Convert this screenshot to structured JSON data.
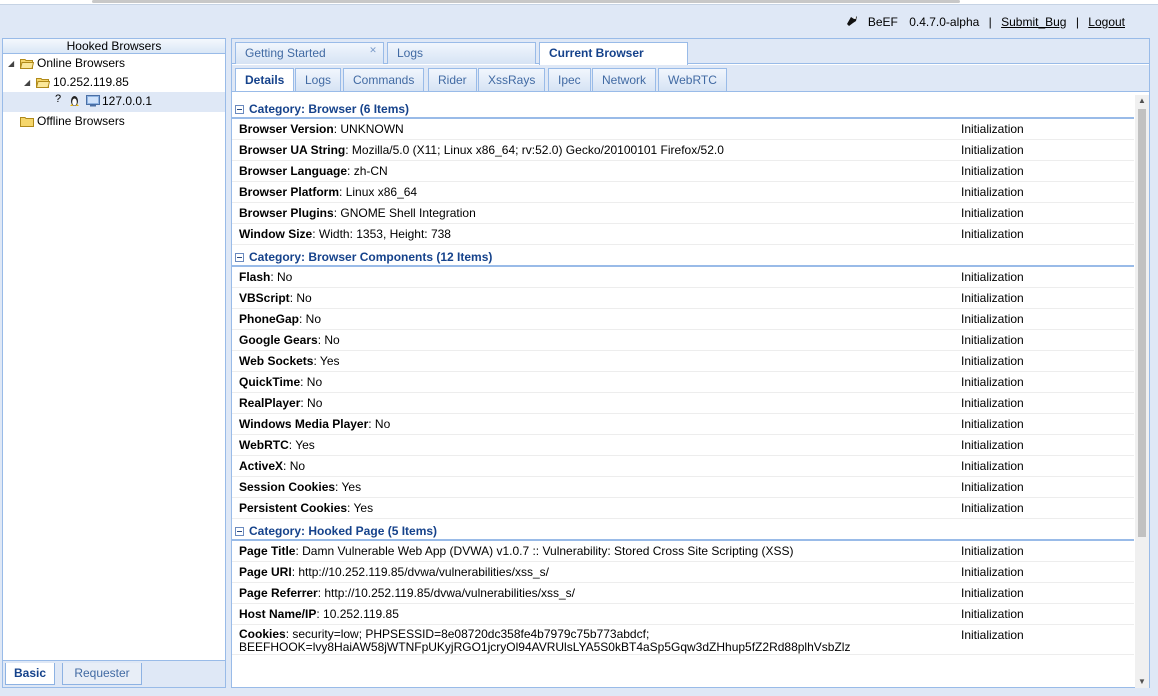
{
  "header": {
    "app_name": "BeEF",
    "version": "0.4.7.0-alpha",
    "submit_bug": "Submit_Bug",
    "logout": "Logout",
    "separator": "|"
  },
  "left_panel": {
    "title": "Hooked Browsers",
    "tree": {
      "online": "Online Browsers",
      "host": "10.252.119.85",
      "browser_ip": "127.0.0.1",
      "browser_unknown_mark": "?",
      "offline": "Offline Browsers"
    },
    "bottom_tabs": [
      "Basic",
      "Requester"
    ]
  },
  "main_tabs": [
    {
      "label": "Getting Started",
      "closable": true
    },
    {
      "label": "Logs"
    },
    {
      "label": "Current Browser",
      "active": true
    }
  ],
  "sub_tabs": [
    "Details",
    "Logs",
    "Commands",
    "Rider",
    "XssRays",
    "Ipec",
    "Network",
    "WebRTC"
  ],
  "categories": [
    {
      "title": "Category: Browser (6 Items)",
      "rows": [
        {
          "key": "Browser Version",
          "value": ": UNKNOWN",
          "source": "Initialization"
        },
        {
          "key": "Browser UA String",
          "value": ": Mozilla/5.0 (X11; Linux x86_64; rv:52.0) Gecko/20100101 Firefox/52.0",
          "source": "Initialization"
        },
        {
          "key": "Browser Language",
          "value": ": zh-CN",
          "source": "Initialization"
        },
        {
          "key": "Browser Platform",
          "value": ": Linux x86_64",
          "source": "Initialization"
        },
        {
          "key": "Browser Plugins",
          "value": ": GNOME Shell Integration",
          "source": "Initialization"
        },
        {
          "key": "Window Size",
          "value": ": Width: 1353, Height: 738",
          "source": "Initialization"
        }
      ]
    },
    {
      "title": "Category: Browser Components (12 Items)",
      "rows": [
        {
          "key": "Flash",
          "value": ": No",
          "source": "Initialization"
        },
        {
          "key": "VBScript",
          "value": ": No",
          "source": "Initialization"
        },
        {
          "key": "PhoneGap",
          "value": ": No",
          "source": "Initialization"
        },
        {
          "key": "Google Gears",
          "value": ": No",
          "source": "Initialization"
        },
        {
          "key": "Web Sockets",
          "value": ": Yes",
          "source": "Initialization"
        },
        {
          "key": "QuickTime",
          "value": ": No",
          "source": "Initialization"
        },
        {
          "key": "RealPlayer",
          "value": ": No",
          "source": "Initialization"
        },
        {
          "key": "Windows Media Player",
          "value": ": No",
          "source": "Initialization"
        },
        {
          "key": "WebRTC",
          "value": ": Yes",
          "source": "Initialization"
        },
        {
          "key": "ActiveX",
          "value": ": No",
          "source": "Initialization"
        },
        {
          "key": "Session Cookies",
          "value": ": Yes",
          "source": "Initialization"
        },
        {
          "key": "Persistent Cookies",
          "value": ": Yes",
          "source": "Initialization"
        }
      ]
    },
    {
      "title": "Category: Hooked Page (5 Items)",
      "rows": [
        {
          "key": "Page Title",
          "value": ": Damn Vulnerable Web App (DVWA) v1.0.7 :: Vulnerability: Stored Cross Site Scripting (XSS)",
          "source": "Initialization"
        },
        {
          "key": "Page URI",
          "value": ": http://10.252.119.85/dvwa/vulnerabilities/xss_s/",
          "source": "Initialization"
        },
        {
          "key": "Page Referrer",
          "value": ": http://10.252.119.85/dvwa/vulnerabilities/xss_s/",
          "source": "Initialization"
        },
        {
          "key": "Host Name/IP",
          "value": ": 10.252.119.85",
          "source": "Initialization"
        },
        {
          "key": "Cookies",
          "value": ": security=low; PHPSESSID=8e08720dc358fe4b7979c75b773abdcf; BEEFHOOK=lvy8HaiAW58jWTNFpUKyjRGO1jcryOl94AVRUlsLYA5S0kBT4aSp5Gqw3dZHhup5fZ2Rd88plhVsbZlz",
          "source": "Initialization",
          "tall": true
        }
      ]
    }
  ],
  "colors": {
    "accent": "#15428b",
    "panel_bg": "#dfe8f6",
    "border": "#99bbe8"
  }
}
